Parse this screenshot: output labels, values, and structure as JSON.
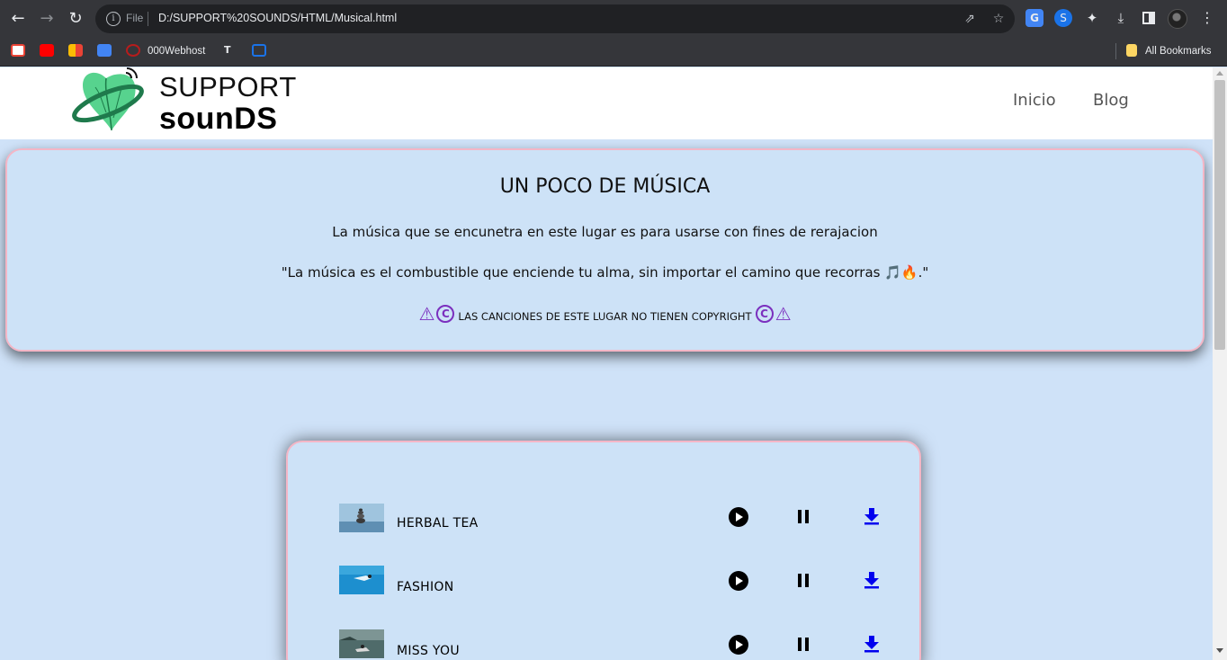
{
  "browser": {
    "url_scheme": "File",
    "url": "D:/SUPPORT%20SOUNDS/HTML/Musical.html",
    "bookmarks": [
      {
        "label": "000Webhost"
      },
      {
        "label": "All Bookmarks"
      }
    ]
  },
  "site": {
    "brand_top": "SUPPORT",
    "brand_bottom": "sounDS",
    "nav": [
      {
        "label": "Inicio"
      },
      {
        "label": "Blog"
      }
    ]
  },
  "intro": {
    "title": "UN POCO DE MÚSICA",
    "line": "La música que se encunetra en este lugar es para usarse con fines de rerajacion",
    "quote": "\"La música es el combustible que enciende tu alma, sin importar el camino que recorras 🎵🔥.\"",
    "notice": "LAS CANCIONES DE ESTE LUGAR NO TIENEN COPYRIGHT",
    "warn_glyph": "⚠",
    "copyright_glyph": "C",
    "accent_color": "#7b2fbe"
  },
  "tracks": [
    {
      "title": "HERBAL TEA",
      "thumbnail": "stones-on-water"
    },
    {
      "title": "FASHION",
      "thumbnail": "swimmer-in-pool"
    },
    {
      "title": "MISS YOU",
      "thumbnail": "boat-on-river"
    }
  ],
  "colors": {
    "page_bg": "#cfe2f8",
    "card_border": "#f4b6c6",
    "download_color": "#0000ee"
  }
}
